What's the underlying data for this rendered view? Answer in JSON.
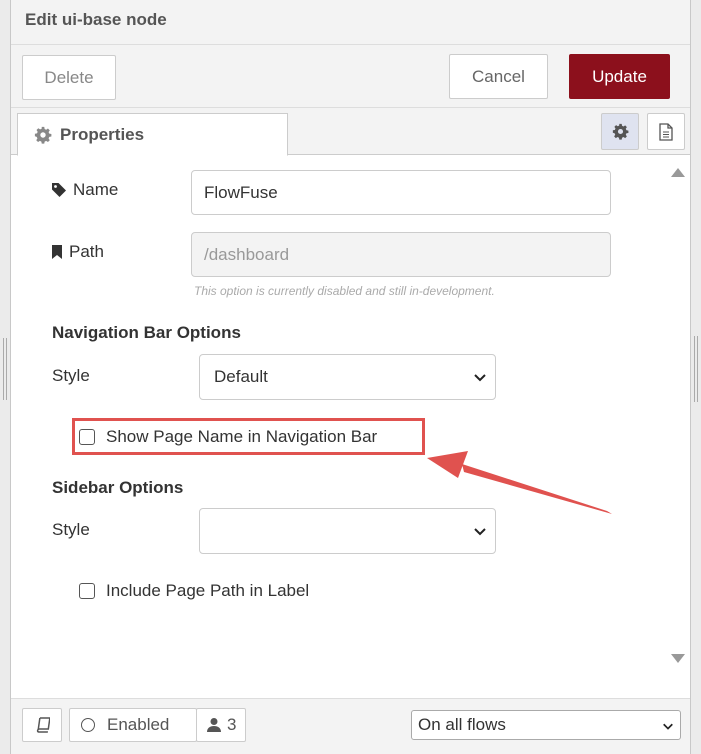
{
  "tray": {
    "title": "Edit ui-base node"
  },
  "toolbar": {
    "delete_label": "Delete",
    "cancel_label": "Cancel",
    "update_label": "Update"
  },
  "tabs": {
    "properties_label": "Properties"
  },
  "form": {
    "name_label": "Name",
    "name_value": "FlowFuse",
    "path_label": "Path",
    "path_placeholder": "/dashboard",
    "path_hint": "This option is currently disabled and still in-development.",
    "nav_section_title": "Navigation Bar Options",
    "nav_style_label": "Style",
    "nav_style_value": "Default",
    "show_page_name_label": "Show Page Name in Navigation Bar",
    "sidebar_section_title": "Sidebar Options",
    "sidebar_style_label": "Style",
    "sidebar_style_value": "",
    "include_path_label": "Include Page Path in Label"
  },
  "footer": {
    "enabled_label": "Enabled",
    "users_count": "3",
    "flow_scope": "On all flows"
  },
  "colors": {
    "update_button": "#8c101c",
    "highlight": "#e0524f",
    "settings_tab_active": "#dfe3f0"
  },
  "icons": [
    "cog-icon",
    "file-icon",
    "tag-icon",
    "bookmark-icon",
    "book-icon",
    "user-icon",
    "chevron-down-icon",
    "arrow-icon"
  ]
}
